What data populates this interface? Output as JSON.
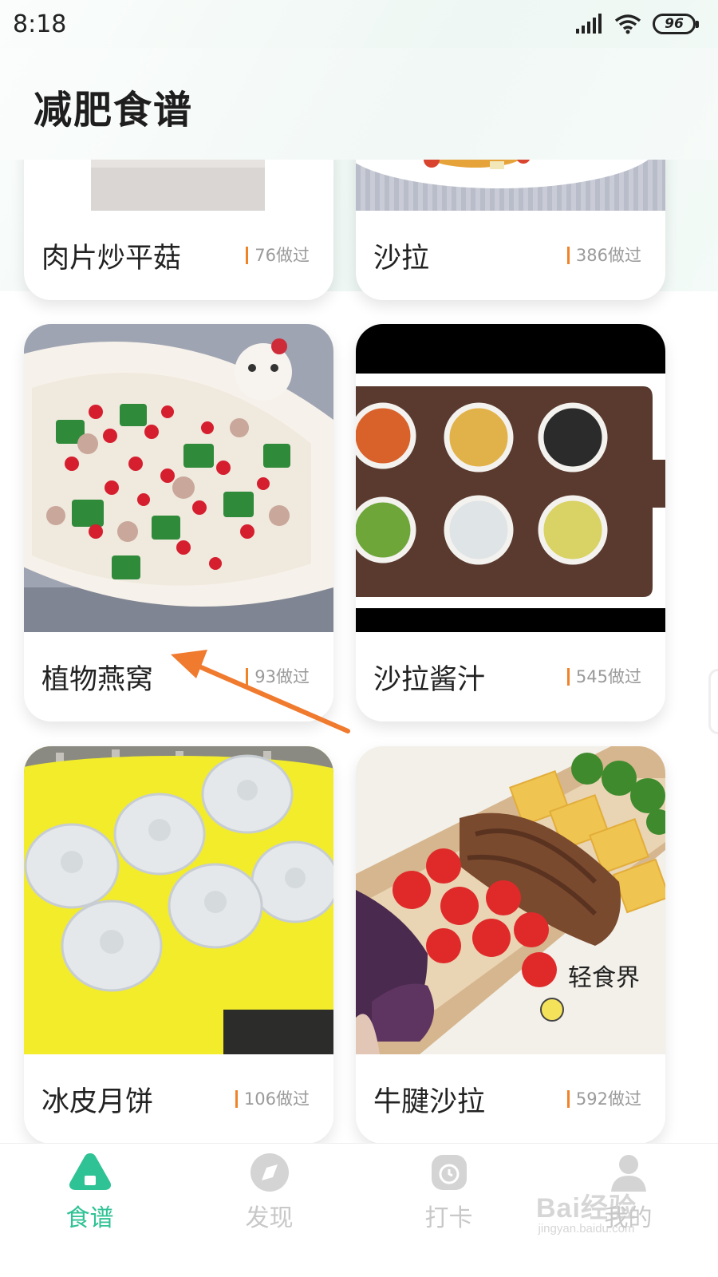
{
  "status_bar": {
    "time": "8:18",
    "battery": "96"
  },
  "header": {
    "title": "减肥食谱"
  },
  "recipes": [
    {
      "name": "肉片炒平菇",
      "count": "76做过"
    },
    {
      "name": "沙拉",
      "count": "386做过"
    },
    {
      "name": "植物燕窝",
      "count": "93做过"
    },
    {
      "name": "沙拉酱汁",
      "count": "545做过"
    },
    {
      "name": "冰皮月饼",
      "count": "106做过"
    },
    {
      "name": "牛腱沙拉",
      "count": "592做过"
    }
  ],
  "image_text": {
    "bento_caption": "轻食界"
  },
  "tabs": [
    {
      "label": "食谱",
      "icon": "recipe-icon",
      "active": true
    },
    {
      "label": "发现",
      "icon": "discover-icon",
      "active": false
    },
    {
      "label": "打卡",
      "icon": "checkin-icon",
      "active": false
    },
    {
      "label": "我的",
      "icon": "profile-icon",
      "active": false
    }
  ],
  "watermark": {
    "brand": "Bai经验",
    "site": "jingyan.baidu.com"
  },
  "colors": {
    "accent": "#2fc294",
    "count_bar": "#f0832a",
    "annotation_arrow": "#f07a2e"
  }
}
